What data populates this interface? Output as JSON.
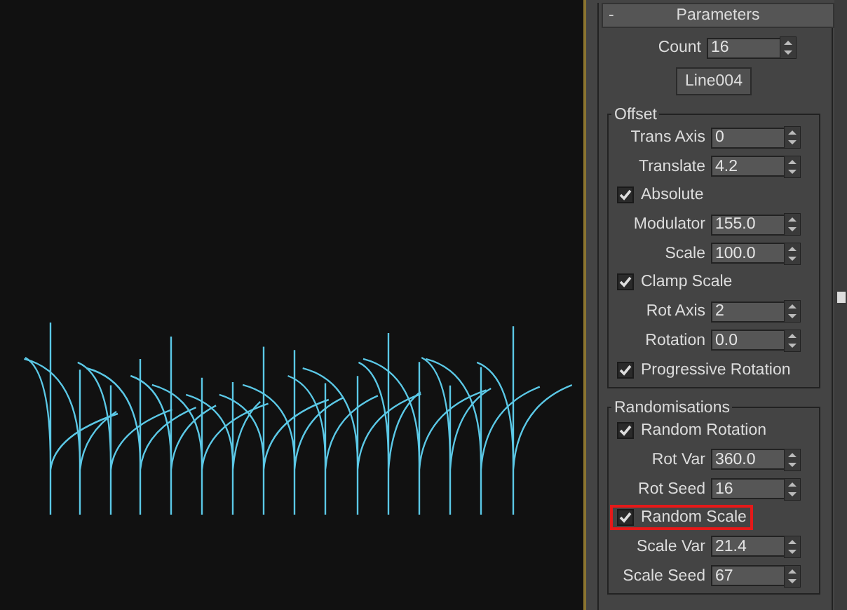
{
  "rollout": {
    "collapse_symbol": "-",
    "title": "Parameters"
  },
  "count": {
    "label": "Count",
    "value": "16"
  },
  "pick_button": {
    "label": "Line004"
  },
  "groups": [
    {
      "title": "Offset",
      "rows": [
        {
          "kind": "spinner",
          "label": "Trans Axis",
          "value": "0"
        },
        {
          "kind": "spinner",
          "label": "Translate",
          "value": "4.2"
        },
        {
          "kind": "checkbox",
          "label": "Absolute",
          "checked": true,
          "highlighted": false
        },
        {
          "kind": "spinner",
          "label": "Modulator",
          "value": "155.0"
        },
        {
          "kind": "spinner",
          "label": "Scale",
          "value": "100.0"
        },
        {
          "kind": "checkbox",
          "label": "Clamp Scale",
          "checked": true,
          "highlighted": false
        },
        {
          "kind": "spinner",
          "label": "Rot Axis",
          "value": "2"
        },
        {
          "kind": "spinner",
          "label": "Rotation",
          "value": "0.0"
        },
        {
          "kind": "checkbox",
          "label": "Progressive Rotation",
          "checked": true,
          "highlighted": false
        }
      ]
    },
    {
      "title": "Randomisations",
      "rows": [
        {
          "kind": "checkbox",
          "label": "Random Rotation",
          "checked": true,
          "highlighted": false
        },
        {
          "kind": "spinner",
          "label": "Rot Var",
          "value": "360.0"
        },
        {
          "kind": "spinner",
          "label": "Rot Seed",
          "value": "16"
        },
        {
          "kind": "checkbox",
          "label": "Random Scale",
          "checked": true,
          "highlighted": true
        },
        {
          "kind": "spinner",
          "label": "Scale Var",
          "value": "21.4"
        },
        {
          "kind": "spinner",
          "label": "Scale Seed",
          "value": "67"
        }
      ]
    }
  ]
}
